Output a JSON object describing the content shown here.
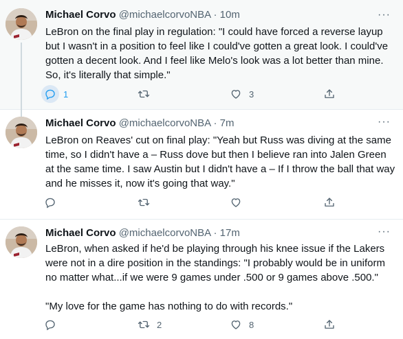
{
  "tweets": [
    {
      "author_name": "Michael Corvo",
      "handle": "@michaelcorvoNBA",
      "separator": "·",
      "time": "10m",
      "paragraphs": [
        "LeBron on the final play in regulation: \"I could have forced a reverse layup but I wasn't in a position to feel like I could've gotten a great look. I could've gotten a decent look. And I feel like Melo's look was a lot better than mine. So, it's literally that simple.\""
      ],
      "reply_count": "1",
      "retweet_count": "",
      "like_count": "3",
      "more_label": "···"
    },
    {
      "author_name": "Michael Corvo",
      "handle": "@michaelcorvoNBA",
      "separator": "·",
      "time": "7m",
      "paragraphs": [
        "LeBron on Reaves' cut on final play: \"Yeah but Russ was diving at the same time, so I didn't have a – Russ dove but then I believe ran into Jalen Green at the same time. I saw Austin but I didn't have a – If I throw the ball that way and he misses it, now it's going that way.\""
      ],
      "reply_count": "",
      "retweet_count": "",
      "like_count": "",
      "more_label": "···"
    },
    {
      "author_name": "Michael Corvo",
      "handle": "@michaelcorvoNBA",
      "separator": "·",
      "time": "17m",
      "paragraphs": [
        "LeBron, when asked if he'd be playing through his knee issue if the Lakers were not in a dire position in the standings: \"I probably would be in uniform no matter what...if we were 9 games under .500 or 9 games above .500.\"",
        "\"My love for the game has nothing to do with records.\""
      ],
      "reply_count": "",
      "retweet_count": "2",
      "like_count": "8",
      "more_label": "···"
    }
  ],
  "icons": {
    "reply": "reply-icon",
    "retweet": "retweet-icon",
    "like": "heart-icon",
    "share": "share-icon",
    "more": "more-icon"
  },
  "colors": {
    "accent": "#1d9bf0",
    "muted": "#536471",
    "text": "#0f1419",
    "highlight_bg": "#f7f9f9"
  }
}
